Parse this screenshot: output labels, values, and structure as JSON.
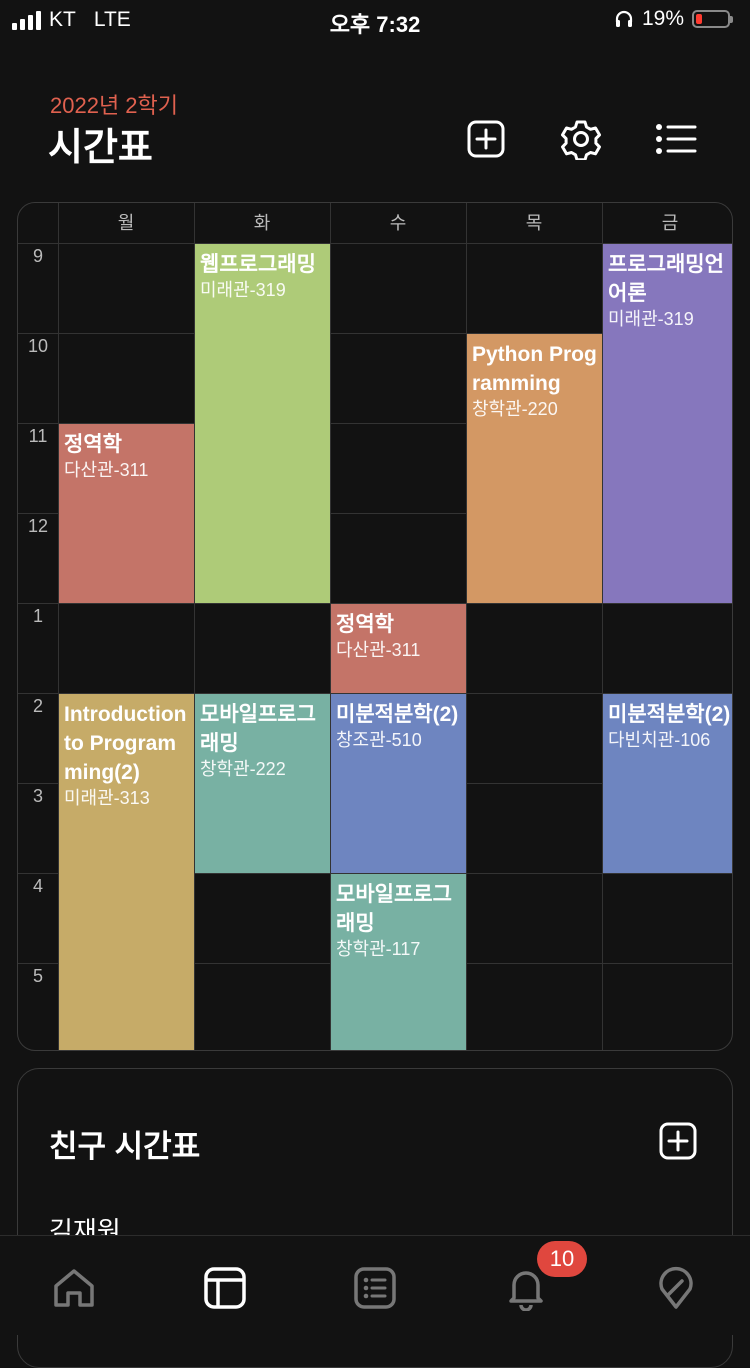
{
  "status_bar": {
    "carrier": "KT",
    "network": "LTE",
    "time": "오후 7:32",
    "battery": "19%",
    "battery_level": 0.19
  },
  "header": {
    "semester": "2022년 2학기",
    "title": "시간표",
    "icons": [
      "add-icon",
      "gear-icon",
      "list-icon"
    ]
  },
  "timetable": {
    "days": [
      "월",
      "화",
      "수",
      "목",
      "금"
    ],
    "hours": [
      "9",
      "10",
      "11",
      "12",
      "1",
      "2",
      "3",
      "4",
      "5"
    ],
    "courses": [
      {
        "name": "웹프로그래밍",
        "room": "미래관-319",
        "day": 1,
        "start": 0,
        "duration": 4,
        "color": "#aecb78"
      },
      {
        "name": "프로그래밍언어론",
        "room": "미래관-319",
        "day": 4,
        "start": 0,
        "duration": 4,
        "color": "#8677bd"
      },
      {
        "name": "Python Programming",
        "room": "창학관-220",
        "day": 3,
        "start": 1,
        "duration": 3,
        "color": "#d39864"
      },
      {
        "name": "정역학",
        "room": "다산관-311",
        "day": 0,
        "start": 2,
        "duration": 2,
        "color": "#c47468"
      },
      {
        "name": "정역학",
        "room": "다산관-311",
        "day": 2,
        "start": 4,
        "duration": 1,
        "color": "#c47468"
      },
      {
        "name": "Introduction to Programming(2)",
        "room": "미래관-313",
        "day": 0,
        "start": 5,
        "duration": 4,
        "color": "#c6ab68"
      },
      {
        "name": "모바일프로그래밍",
        "room": "창학관-222",
        "day": 1,
        "start": 5,
        "duration": 2,
        "color": "#78b1a3"
      },
      {
        "name": "미분적분학(2)",
        "room": "창조관-510",
        "day": 2,
        "start": 5,
        "duration": 2,
        "color": "#6e85c0"
      },
      {
        "name": "미분적분학(2)",
        "room": "다빈치관-106",
        "day": 4,
        "start": 5,
        "duration": 2,
        "color": "#6e85c0"
      },
      {
        "name": "모바일프로그래밍",
        "room": "창학관-117",
        "day": 2,
        "start": 7,
        "duration": 2,
        "color": "#78b1a3"
      }
    ]
  },
  "friends": {
    "title": "친구 시간표",
    "add_icon": "add-icon",
    "items": [
      {
        "name": "김재원"
      }
    ]
  },
  "tabbar": {
    "tabs": [
      {
        "icon": "home-icon",
        "active": false
      },
      {
        "icon": "timetable-icon",
        "active": true
      },
      {
        "icon": "list-icon",
        "active": false
      },
      {
        "icon": "bell-icon",
        "active": false
      },
      {
        "icon": "campus-icon",
        "active": false
      }
    ],
    "notification_count": "10"
  }
}
